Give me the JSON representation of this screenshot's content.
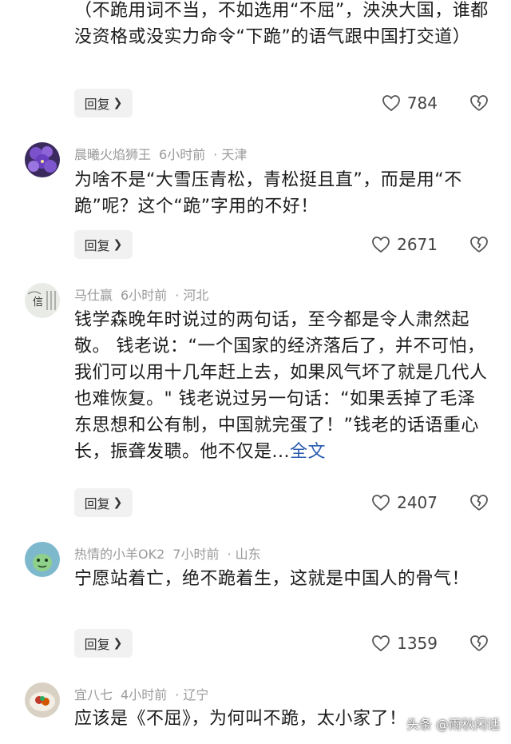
{
  "comments": [
    {
      "user": "",
      "time": "",
      "location": "",
      "text": "（不跪用词不当，不如选用“不屈”，泱泱大国，谁都没资格或没实力命令“下跪”的语气跟中国打交道）",
      "more": "",
      "reply_label": "回复",
      "likes": "784"
    },
    {
      "user": "晨曦火焰狮王",
      "time": "6小时前",
      "location": "· 天津",
      "text": "为啥不是“大雪压青松，青松挺且直”，而是用“不跪”呢？这个“跪”字用的不好！",
      "more": "",
      "reply_label": "回复",
      "likes": "2671"
    },
    {
      "user": "马仕赢",
      "time": "6小时前",
      "location": "· 河北",
      "text": "钱学森晚年时说过的两句话，至今都是令人肃然起敬。 钱老说：“一个国家的经济落后了，并不可怕，我们可以用十几年赶上去，如果风气坏了就是几代人也难恢复。\" 钱老说过另一句话：“如果丢掉了毛泽东思想和公有制，中国就完蛋了！”钱老的话语重心长，振聋发聩。他不仅是...",
      "more": "全文",
      "reply_label": "回复",
      "likes": "2407"
    },
    {
      "user": "热情的小羊OK2",
      "time": "7小时前",
      "location": "· 山东",
      "text": "宁愿站着亡，绝不跪着生，这就是中国人的骨气！",
      "more": "",
      "reply_label": "回复",
      "likes": "1359"
    },
    {
      "user": "宜八七",
      "time": "4小时前",
      "location": "· 辽宁",
      "text": "应该是《不屈》，为何叫不跪，太小家了！",
      "more": "",
      "reply_label": "",
      "likes": ""
    }
  ],
  "watermark": "头条 @雨秋闲话",
  "colors": {
    "link": "#2a5db0",
    "meta": "#9a9a9a",
    "reply_bg": "#f1f1f1"
  }
}
